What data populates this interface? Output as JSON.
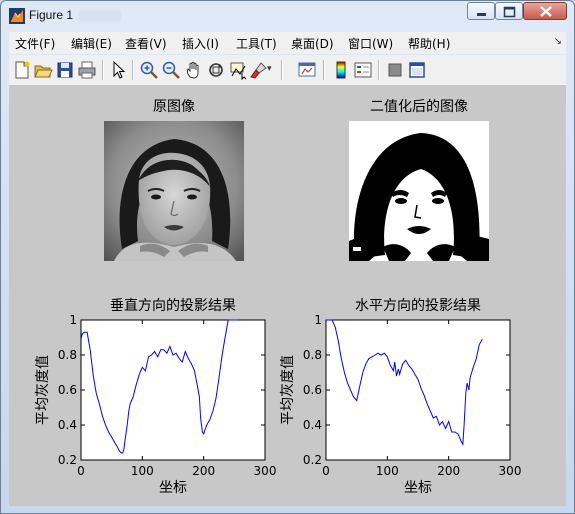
{
  "window": {
    "title": "Figure 1",
    "icon": "matlab-figure-icon",
    "controls": [
      "minimize-icon",
      "maximize-icon",
      "close-icon"
    ]
  },
  "menu": {
    "items": [
      "文件(F)",
      "编辑(E)",
      "查看(V)",
      "插入(I)",
      "工具(T)",
      "桌面(D)",
      "窗口(W)",
      "帮助(H)"
    ],
    "overflow_icon": "dock-arrow-icon"
  },
  "toolbar": {
    "icons": [
      "new-figure-icon",
      "open-file-icon",
      "save-icon",
      "print-icon",
      "edit-plot-icon",
      "zoom-in-icon",
      "zoom-out-icon",
      "pan-icon",
      "rotate-3d-icon",
      "data-cursor-icon",
      "brush-icon",
      "brush-dropdown-icon",
      "link-plot-icon",
      "colorbar-icon",
      "legend-icon",
      "hide-plot-tools-icon",
      "show-plot-tools-icon"
    ]
  },
  "figure": {
    "background": "#c8c8c8",
    "images": [
      {
        "title": "原图像",
        "kind": "grayscale-photo"
      },
      {
        "title": "二值化后的图像",
        "kind": "binary-photo"
      }
    ]
  },
  "chart_data": [
    {
      "type": "line",
      "title": "垂直方向的投影结果",
      "xlabel": "坐标",
      "ylabel": "平均灰度值",
      "xlim": [
        0,
        300
      ],
      "ylim": [
        0.2,
        1
      ],
      "xticks": [
        0,
        100,
        200,
        300
      ],
      "yticks": [
        0.2,
        0.4,
        0.6,
        0.8,
        1
      ],
      "xtick_labels": [
        "0",
        "100",
        "200",
        "300"
      ],
      "ytick_labels": [
        "0.2",
        "0.4",
        "0.6",
        "0.8",
        "1"
      ],
      "series": [
        {
          "color": "#0000ff",
          "x": [
            0,
            2,
            5,
            10,
            15,
            20,
            25,
            30,
            35,
            40,
            45,
            50,
            55,
            60,
            63,
            66,
            68,
            70,
            72,
            75,
            78,
            80,
            85,
            90,
            95,
            100,
            105,
            110,
            115,
            120,
            125,
            130,
            135,
            140,
            145,
            150,
            155,
            160,
            165,
            170,
            175,
            180,
            185,
            190,
            193,
            195,
            198,
            200,
            203,
            205,
            210,
            215,
            220,
            225,
            230,
            235,
            240,
            245,
            250,
            255,
            256
          ],
          "y": [
            0.89,
            0.92,
            0.93,
            0.93,
            0.83,
            0.68,
            0.58,
            0.52,
            0.45,
            0.4,
            0.36,
            0.33,
            0.3,
            0.27,
            0.25,
            0.24,
            0.24,
            0.26,
            0.32,
            0.39,
            0.48,
            0.52,
            0.56,
            0.63,
            0.69,
            0.73,
            0.71,
            0.79,
            0.8,
            0.82,
            0.79,
            0.83,
            0.83,
            0.81,
            0.85,
            0.8,
            0.81,
            0.78,
            0.76,
            0.82,
            0.78,
            0.75,
            0.71,
            0.62,
            0.56,
            0.44,
            0.36,
            0.35,
            0.38,
            0.4,
            0.43,
            0.48,
            0.55,
            0.67,
            0.8,
            0.9,
            1.0,
            1.0,
            1.0,
            1.0,
            1.0
          ]
        }
      ]
    },
    {
      "type": "line",
      "title": "水平方向的投影结果",
      "xlabel": "坐标",
      "ylabel": "平均灰度值",
      "xlim": [
        0,
        300
      ],
      "ylim": [
        0.2,
        1
      ],
      "xticks": [
        0,
        100,
        200,
        300
      ],
      "yticks": [
        0.2,
        0.4,
        0.6,
        0.8,
        1
      ],
      "xtick_labels": [
        "0",
        "100",
        "200",
        "300"
      ],
      "ytick_labels": [
        "0.2",
        "0.4",
        "0.6",
        "0.8",
        "1"
      ],
      "series": [
        {
          "color": "#0000ff",
          "x": [
            0,
            5,
            10,
            15,
            20,
            25,
            30,
            35,
            40,
            45,
            50,
            55,
            60,
            65,
            70,
            75,
            80,
            85,
            90,
            95,
            100,
            105,
            110,
            112,
            115,
            118,
            120,
            125,
            130,
            135,
            140,
            145,
            150,
            155,
            160,
            165,
            170,
            175,
            180,
            185,
            190,
            195,
            200,
            205,
            210,
            215,
            220,
            223,
            225,
            228,
            230,
            233,
            235,
            240,
            245,
            250,
            255
          ],
          "y": [
            1.0,
            1.0,
            1.0,
            0.96,
            0.88,
            0.78,
            0.7,
            0.64,
            0.6,
            0.56,
            0.54,
            0.62,
            0.7,
            0.75,
            0.78,
            0.79,
            0.8,
            0.81,
            0.8,
            0.81,
            0.79,
            0.74,
            0.71,
            0.76,
            0.68,
            0.72,
            0.69,
            0.75,
            0.77,
            0.74,
            0.72,
            0.69,
            0.66,
            0.61,
            0.57,
            0.52,
            0.48,
            0.44,
            0.45,
            0.4,
            0.42,
            0.38,
            0.42,
            0.36,
            0.36,
            0.35,
            0.31,
            0.29,
            0.39,
            0.58,
            0.64,
            0.6,
            0.67,
            0.73,
            0.78,
            0.86,
            0.89
          ]
        }
      ]
    }
  ]
}
